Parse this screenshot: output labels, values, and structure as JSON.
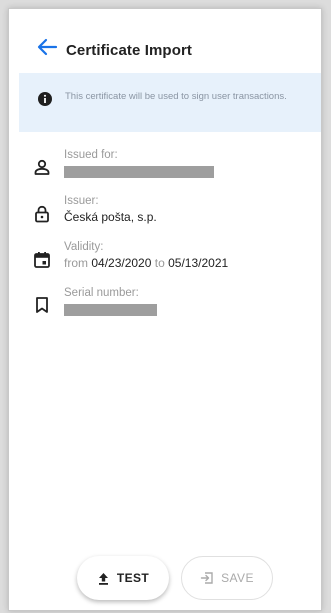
{
  "header": {
    "title": "Certificate Import",
    "back_icon": "arrow-left-icon"
  },
  "info": {
    "icon": "info-icon",
    "text": "This certificate will be used to sign user transactions."
  },
  "fields": {
    "issued_for": {
      "label": "Issued for:",
      "icon": "person-icon"
    },
    "issuer": {
      "label": "Issuer:",
      "value": "Česká pošta, s.p.",
      "icon": "lock-icon"
    },
    "validity": {
      "label": "Validity:",
      "from_word": "from",
      "from_date": "04/23/2020",
      "to_word": "to",
      "to_date": "05/13/2021",
      "icon": "calendar-icon"
    },
    "serial": {
      "label": "Serial number:",
      "icon": "bookmark-icon"
    }
  },
  "actions": {
    "test_label": "TEST",
    "test_icon": "upload-icon",
    "save_label": "SAVE",
    "save_icon": "login-icon"
  },
  "colors": {
    "accent": "#1a73e8",
    "banner_bg": "#e7f1fb"
  }
}
